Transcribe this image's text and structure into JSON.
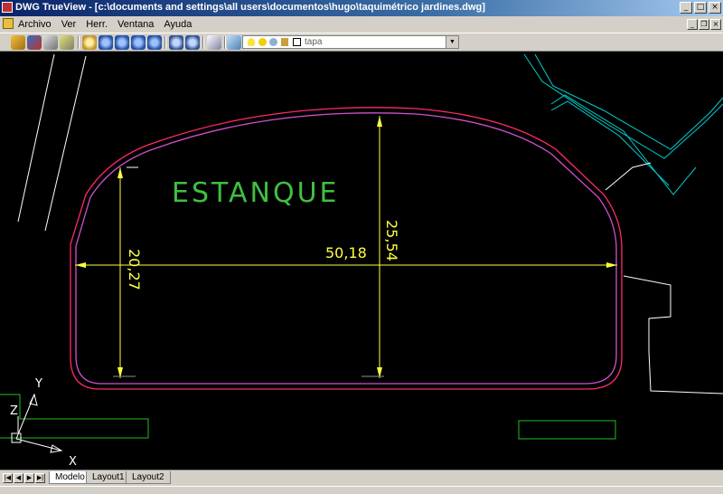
{
  "window": {
    "title": "DWG TrueView - [c:\\documents and settings\\all users\\documentos\\hugo\\taquimétrico jardines.dwg]",
    "minimize": "_",
    "maximize": "□",
    "close": "×",
    "doc_minimize": "_",
    "doc_restore": "❐",
    "doc_close": "×"
  },
  "menu": [
    "Archivo",
    "Ver",
    "Herr.",
    "Ventana",
    "Ayuda"
  ],
  "toolbar": {
    "icons": [
      "open-icon",
      "publish-icon",
      "plot-icon",
      "batch-plot-icon",
      "pan-icon",
      "zoom-realtime-icon",
      "zoom-window-icon",
      "zoom-extents-icon",
      "zoom-previous-icon",
      "zoom-in-icon",
      "zoom-out-icon",
      "markup-icon",
      "layers-icon"
    ],
    "layer_name": "tapa",
    "layer_dropdown": "▼"
  },
  "drawing": {
    "label_pond": "ESTANQUE",
    "dim_width": "50,18",
    "dim_height_center": "25,54",
    "dim_height_left": "20,27",
    "ucs_x": "X",
    "ucs_y": "Y",
    "ucs_z": "Z",
    "colors": {
      "background": "#000000",
      "pond_outline": "#ff2a6a",
      "pond_inner": "#d050d0",
      "dimension": "#ffff40",
      "label": "#40c040",
      "cyan_lines": "#00d0d0",
      "white_lines": "#ffffff",
      "green_boxes": "#20c020"
    }
  },
  "tabs": {
    "nav": [
      "|◀",
      "◀",
      "▶",
      "▶|"
    ],
    "items": [
      "Modelo",
      "Layout1",
      "Layout2"
    ],
    "active": "Modelo"
  }
}
